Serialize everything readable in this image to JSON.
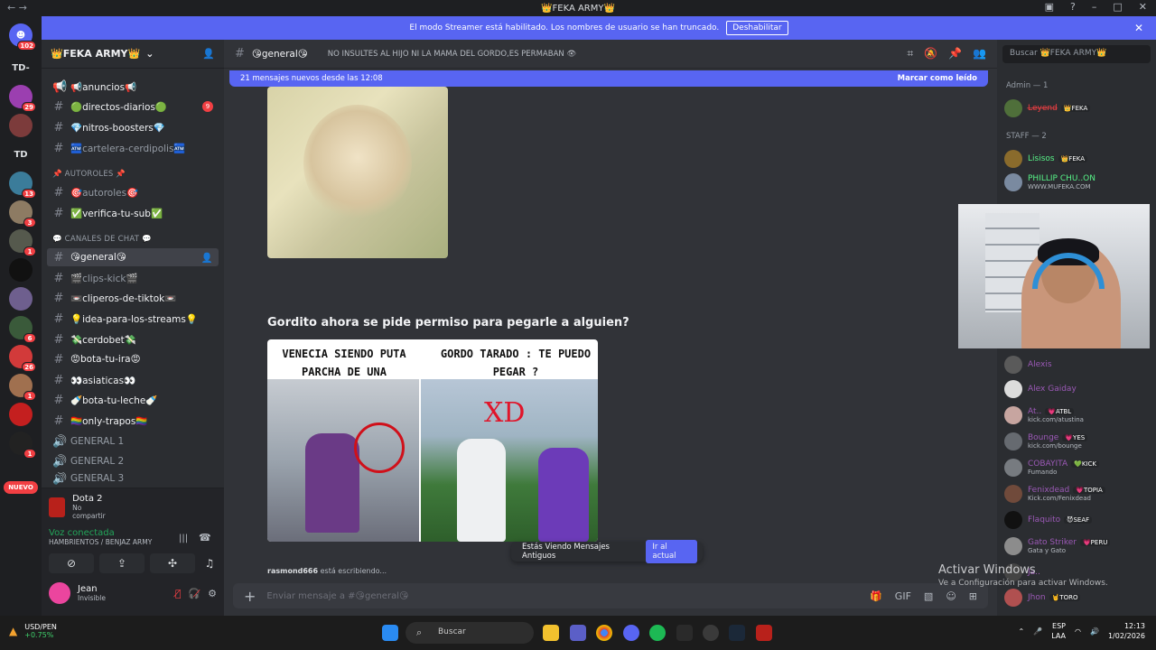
{
  "window": {
    "title": "👑FEKA ARMY👑"
  },
  "banner": {
    "text": "El modo Streamer está habilitado. Los nombres de usuario se han truncado.",
    "button": "Deshabilitar"
  },
  "rail": {
    "badges": {
      "home": "102",
      "s2": "29",
      "s5": "13",
      "s6": "3",
      "s7": "1",
      "s10": "6",
      "s11": "26",
      "s12": "1",
      "s14": "1"
    },
    "text_servers": [
      "TD-",
      "TD"
    ],
    "nuevo": "NUEVO"
  },
  "sidebar": {
    "server_name": "👑FEKA ARMY👑",
    "channels_top": [
      {
        "name": "📢anuncios📢",
        "mbadge": ""
      },
      {
        "name": "🟢directos-diarios🟢",
        "mbadge": "9"
      },
      {
        "name": "💎nitros-boosters💎",
        "mbadge": ""
      },
      {
        "name": "🏧cartelera-cerdipolis🏧",
        "mbadge": ""
      }
    ],
    "cat_autoroles": "📌 AUTOROLES 📌",
    "channels_auto": [
      "🎯autoroles🎯",
      "✅verifica-tu-sub✅"
    ],
    "cat_chat": "💬 CANALES DE CHAT 💬",
    "channels_chat": [
      "😘general😘",
      "🎬clips-kick🎬",
      "📼cliperos-de-tiktok📼",
      "💡idea-para-los-streams💡",
      "💸cerdobet💸",
      "😡bota-tu-ira😡",
      "👀asiaticas👀",
      "🍼bota-tu-leche🍼",
      "🏳‍🌈only-trapos🏳‍🌈"
    ],
    "voice": [
      "GENERAL 1",
      "GENERAL 2",
      "GENERAL 3"
    ],
    "game": {
      "title": "Dota 2",
      "sub": "No compartir"
    },
    "voice_conn": {
      "title": "Voz conectada",
      "sub": "HAMBRIENTOS / BENJAZ ARMY"
    },
    "user": {
      "name": "Jean",
      "status": "Invisible"
    }
  },
  "chat": {
    "channel": "😘general😘",
    "topic": "NO INSULTES AL HIJO NI LA MAMA DEL GORDO,ES PERMABAN 👁",
    "new_messages": "21 mensajes nuevos desde las 12:08",
    "mark_read": "Marcar como leído",
    "message_text": "Gordito ahora se pide permiso para pegarle a alguien?",
    "meme_left": "VENECIA SIENDO PUTA PARCHA DE UNA",
    "meme_right": "GORDO TARADO : TE PUEDO PEGAR ?",
    "meme_xd": "XD",
    "old_messages": "Estás Viendo Mensajes Antiguos",
    "go_now": "Ir al actual",
    "typing_user": "rasmond666",
    "typing_rest": "está escribiendo...",
    "composer_placeholder": "Enviar mensaje a #😘general😘"
  },
  "members": {
    "search_placeholder": "Buscar 👑FEKA ARMY👑",
    "group_admin": "Admin — 1",
    "group_staff": "STAFF — 2",
    "list": [
      {
        "name": "L̶e̶y̶e̶n̶d̶",
        "color": "#f23f43",
        "tag": "👑FEKA",
        "sub": "",
        "avatar": "#4f6f3a"
      },
      {
        "name": "Lisisos",
        "color": "#57f287",
        "tag": "👑FEKA",
        "sub": "",
        "avatar": "#8a6b2c"
      },
      {
        "name": "PHILLIP CHU..ON",
        "color": "#57f287",
        "tag": "",
        "sub": "WWW.MUFEKA.COM",
        "avatar": "#7a8aa0"
      },
      {
        "name": "Alexis",
        "color": "#9b59b6",
        "tag": "",
        "sub": "",
        "avatar": "#5a5a5a"
      },
      {
        "name": "Alex Gaiday",
        "color": "#9b59b6",
        "tag": "",
        "sub": "",
        "avatar": "#dcdcdc"
      },
      {
        "name": "At..",
        "color": "#9b59b6",
        "tag": "💗ATBL",
        "sub": "kick.com/atustina",
        "avatar": "#c7a5a0"
      },
      {
        "name": "Bounge",
        "color": "#9b59b6",
        "tag": "💗YES",
        "sub": "kick.com/bounge",
        "avatar": "#666a70"
      },
      {
        "name": "COBAYITA",
        "color": "#9b59b6",
        "tag": "💚KICK",
        "sub": "Fumando",
        "avatar": "#777b80"
      },
      {
        "name": "Fenixdead",
        "color": "#9b59b6",
        "tag": "💗TOPIA",
        "sub": "Kick.com/Fenixdead",
        "avatar": "#704a3b"
      },
      {
        "name": "Flaquito",
        "color": "#9b59b6",
        "tag": "😈SEAF",
        "sub": "",
        "avatar": "#111111"
      },
      {
        "name": "Gato Striker",
        "color": "#9b59b6",
        "tag": "💗PERU",
        "sub": "Gata y Gato",
        "avatar": "#8c8c8c"
      },
      {
        "name": "Ja..",
        "color": "#9b59b6",
        "tag": "",
        "sub": "",
        "avatar": "#444"
      },
      {
        "name": "Jhon",
        "color": "#9b59b6",
        "tag": "🤘TORO",
        "sub": "",
        "avatar": "#b05050"
      }
    ]
  },
  "watermark": {
    "title": "Activar Windows",
    "sub": "Ve a Configuración para activar Windows."
  },
  "taskbar": {
    "stock_name": "USD/PEN",
    "stock_change": "+0.75%",
    "search": "Buscar",
    "lang": "ESP",
    "lang_sub": "LAA",
    "time": "12:13",
    "date": "1/02/2026"
  }
}
